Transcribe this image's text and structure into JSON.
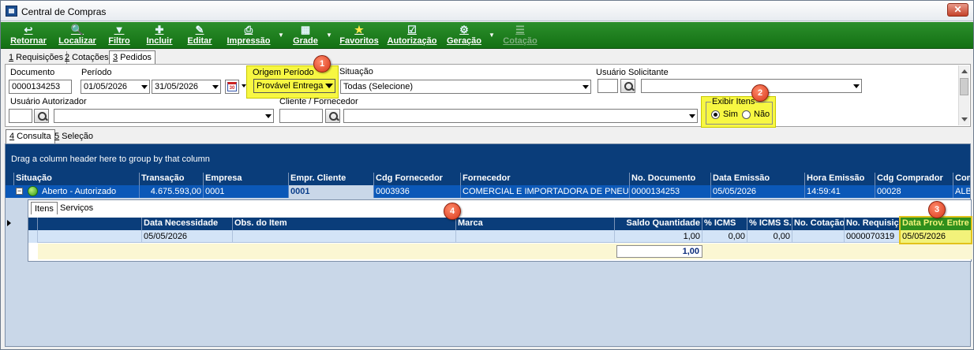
{
  "window": {
    "title": "Central de Compras",
    "close_glyph": "✕"
  },
  "toolbar": {
    "buttons": [
      {
        "label": "Retornar",
        "icon": "return-icon",
        "glyph": "↩"
      },
      {
        "label": "Localizar",
        "icon": "search-icon",
        "glyph": "🔍"
      },
      {
        "label": "Filtro",
        "icon": "filter-icon",
        "glyph": "▼"
      },
      {
        "label": "Incluir",
        "icon": "plus-icon",
        "glyph": "✚"
      },
      {
        "label": "Editar",
        "icon": "edit-icon",
        "glyph": "✎"
      },
      {
        "label": "Impressão",
        "icon": "printer-icon",
        "glyph": "⎙"
      },
      {
        "label": "Grade",
        "icon": "grid-icon",
        "glyph": "▦"
      },
      {
        "label": "Favoritos",
        "icon": "star-icon",
        "glyph": "★"
      },
      {
        "label": "Autorização",
        "icon": "authorize-icon",
        "glyph": "☑"
      },
      {
        "label": "Geração",
        "icon": "generate-icon",
        "glyph": "⚙"
      },
      {
        "label": "Cotação",
        "icon": "quote-icon",
        "glyph": "☰"
      }
    ],
    "dropdown_glyph": "▼"
  },
  "tabs_top": [
    {
      "num": "1",
      "label": " Requisições"
    },
    {
      "num": "2",
      "label": " Cotações"
    },
    {
      "num": "3",
      "label": " Pedidos"
    }
  ],
  "filters": {
    "documento": {
      "label": "Documento",
      "value": "0000134253"
    },
    "periodo": {
      "label": "Período",
      "from": "01/05/2026",
      "to": "31/05/2026"
    },
    "origem": {
      "label": "Origem Período",
      "value": "Provável Entrega"
    },
    "situacao": {
      "label": "Situação",
      "value": "Todas (Selecione)"
    },
    "usuario_solicitante": {
      "label": "Usuário Solicitante",
      "code": "",
      "name": ""
    },
    "usuario_autorizador": {
      "label": "Usuário Autorizador",
      "code": "",
      "name": ""
    },
    "cliente_fornecedor": {
      "label": "Cliente / Fornecedor",
      "code": "",
      "name": ""
    },
    "exibir_itens": {
      "label": "Exibir Itens",
      "sim": "Sim",
      "nao": "Não"
    },
    "calendar_day": "30"
  },
  "badges": [
    "1",
    "2",
    "3",
    "4"
  ],
  "tabs_mid": [
    {
      "num": "4",
      "label": " Consulta"
    },
    {
      "num": "5",
      "label": " Seleção"
    }
  ],
  "grid": {
    "group_hint": "Drag a column header here to group by that column",
    "columns": [
      "Situação",
      "Transação",
      "Empresa",
      "Empr. Cliente",
      "Cdg Fornecedor",
      "Fornecedor",
      "No. Documento",
      "Data Emissão",
      "Hora Emissão",
      "Cdg Comprador",
      "Com"
    ],
    "row": {
      "expander": "−",
      "situacao": "Aberto - Autorizado",
      "transacao": "4.675.593,00",
      "empresa": "0001",
      "empr_cliente": "0001",
      "cdg_fornecedor": "0003936",
      "fornecedor": "COMERCIAL E IMPORTADORA DE PNEUS LTI",
      "no_documento": "0000134253",
      "data_emissao": "05/05/2026",
      "hora_emissao": "14:59:41",
      "cdg_comprador": "00028",
      "com": "ALBE"
    }
  },
  "detail": {
    "tabs": [
      "Itens",
      "Serviços"
    ],
    "columns": [
      "Data Necessidade",
      "Obs. do Item",
      "Marca",
      "Saldo Quantidade",
      "% ICMS",
      "% ICMS S.",
      "No. Cotação",
      "No. Requisição",
      "Data Prov. Entre"
    ],
    "row": {
      "data_necessidade": "05/05/2026",
      "obs_item": "",
      "marca": "",
      "saldo_quantidade": "1,00",
      "icms": "0,00",
      "icms_s": "0,00",
      "no_cotacao": "",
      "no_requisicao": "0000070319",
      "data_prov_entrega": "05/05/2026"
    },
    "total": "1,00"
  }
}
